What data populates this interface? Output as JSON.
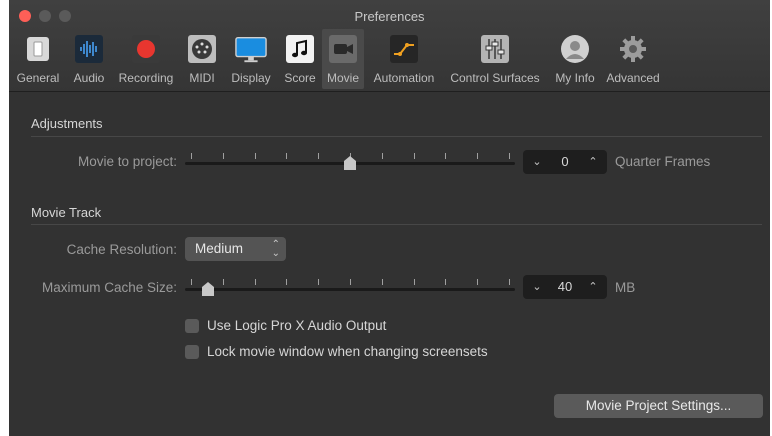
{
  "window": {
    "title": "Preferences"
  },
  "toolbar": {
    "tabs": [
      {
        "label": "General",
        "icon": "general-icon"
      },
      {
        "label": "Audio",
        "icon": "audio-waveform-icon"
      },
      {
        "label": "Recording",
        "icon": "record-icon"
      },
      {
        "label": "MIDI",
        "icon": "midi-connector-icon"
      },
      {
        "label": "Display",
        "icon": "display-monitor-icon"
      },
      {
        "label": "Score",
        "icon": "music-note-icon"
      },
      {
        "label": "Movie",
        "icon": "movie-camera-icon",
        "selected": true
      },
      {
        "label": "Automation",
        "icon": "automation-icon"
      },
      {
        "label": "Control Surfaces",
        "icon": "control-surfaces-icon"
      },
      {
        "label": "My Info",
        "icon": "user-avatar-icon"
      },
      {
        "label": "Advanced",
        "icon": "gear-icon"
      }
    ]
  },
  "adjustments": {
    "title": "Adjustments",
    "movie_to_project_label": "Movie to project:",
    "movie_to_project_value": "0",
    "movie_to_project_unit": "Quarter Frames",
    "movie_to_project_slider_level": 0.5
  },
  "movie_track": {
    "title": "Movie Track",
    "cache_resolution_label": "Cache Resolution:",
    "cache_resolution_value": "Medium",
    "max_cache_label": "Maximum Cache Size:",
    "max_cache_value": "40",
    "max_cache_unit": "MB",
    "max_cache_slider_level": 0.05,
    "use_audio_output_label": "Use Logic Pro X Audio Output",
    "use_audio_output_checked": false,
    "lock_window_label": "Lock movie window when changing screensets",
    "lock_window_checked": false
  },
  "footer": {
    "movie_settings_button": "Movie Project Settings..."
  },
  "colors": {
    "close": "#fe5f57",
    "background": "#323232",
    "recording_red": "#e8362f"
  }
}
